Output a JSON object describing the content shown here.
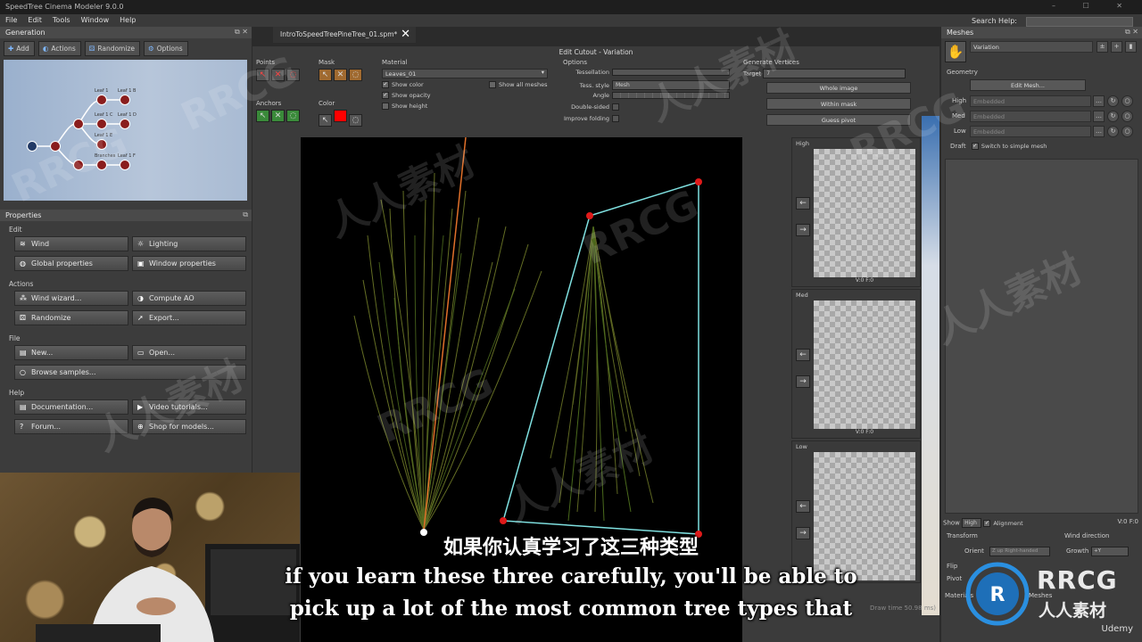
{
  "app": {
    "title": "SpeedTree Cinema Modeler 9.0.0",
    "menu": [
      "File",
      "Edit",
      "Tools",
      "Window",
      "Help"
    ],
    "search_help_label": "Search Help:"
  },
  "generation": {
    "title": "Generation",
    "toolbar": [
      "Add",
      "Actions",
      "Randomize",
      "Options"
    ],
    "node_labels": [
      "Leaf 1",
      "Leaf 1 B",
      "Leaf 1 C",
      "Leaf 1 D",
      "Leaf 1 E",
      "Branches",
      "Leaf 1 F"
    ]
  },
  "properties": {
    "title": "Properties",
    "sections": {
      "edit": "Edit",
      "actions": "Actions",
      "file": "File",
      "help": "Help"
    },
    "buttons": {
      "wind": "Wind",
      "lighting": "Lighting",
      "global_properties": "Global properties",
      "window_properties": "Window properties",
      "wind_wizard": "Wind wizard...",
      "compute_ao": "Compute AO",
      "randomize": "Randomize",
      "export": "Export...",
      "new": "New...",
      "open": "Open...",
      "browse_samples": "Browse samples...",
      "documentation": "Documentation...",
      "video_tutorials": "Video tutorials...",
      "forum": "Forum...",
      "shop_for_models": "Shop for models..."
    }
  },
  "document_tab": "IntroToSpeedTreePineTree_01.spm*",
  "cutout": {
    "title": "Edit Cutout - Variation",
    "groups": {
      "points": "Points",
      "mask": "Mask",
      "anchors": "Anchors",
      "color": "Color",
      "material": "Material",
      "options": "Options",
      "generate_vertices": "Generate Vertices"
    },
    "material_value": "Leaves_01",
    "show_color": "Show color",
    "show_opacity": "Show opacity",
    "show_height": "Show height",
    "show_all_meshes": "Show all meshes",
    "tessellation": "Tessellation",
    "tess_style": "Tess. style",
    "tess_style_value": "Mesh",
    "angle": "Angle",
    "double_sided": "Double-sided",
    "improve_folding": "Improve folding",
    "target_label": "Target",
    "target_value": "7",
    "whole_image": "Whole image",
    "within_mask": "Within mask",
    "guess_pivot": "Guess pivot",
    "mask_color": "#ff0000"
  },
  "lod": [
    {
      "label": "High",
      "stats": "V:0  F:0"
    },
    {
      "label": "Med",
      "stats": "V:0  F:0"
    },
    {
      "label": "Low",
      "stats": "V:0  F:0"
    }
  ],
  "meshes": {
    "title": "Meshes",
    "variation": "Variation",
    "geometry": "Geometry",
    "edit_mesh": "Edit Mesh...",
    "rows": [
      {
        "label": "High",
        "value": "Embedded"
      },
      {
        "label": "Med",
        "value": "Embedded"
      },
      {
        "label": "Low",
        "value": "Embedded"
      }
    ],
    "draft": "Draft",
    "switch_simple": "Switch to simple mesh",
    "show_label": "Show",
    "show_value": "High",
    "alignment": "Alignment",
    "stats": "V:0  F:0",
    "transform": "Transform",
    "orient_label": "Orient",
    "orient_value": "Z up Right-handed",
    "wind_direction": "Wind direction",
    "growth_label": "Growth",
    "growth_value": "+Y",
    "flip": "Flip",
    "pivot": "Pivot",
    "bottom_tabs": [
      "Materials",
      "Meshes"
    ]
  },
  "viewport_status": "Draw time 50.98 ms)",
  "subtitles": {
    "cn": "如果你认真学习了这三种类型",
    "en1": "if you learn these three carefully, you'll be able to",
    "en2": "pick up a lot of the most common tree types that"
  },
  "watermarks": [
    "RRCG",
    "人人素材"
  ],
  "logo": {
    "brand": "RRCG",
    "sub": "人人素材"
  },
  "udemy": "Udemy"
}
